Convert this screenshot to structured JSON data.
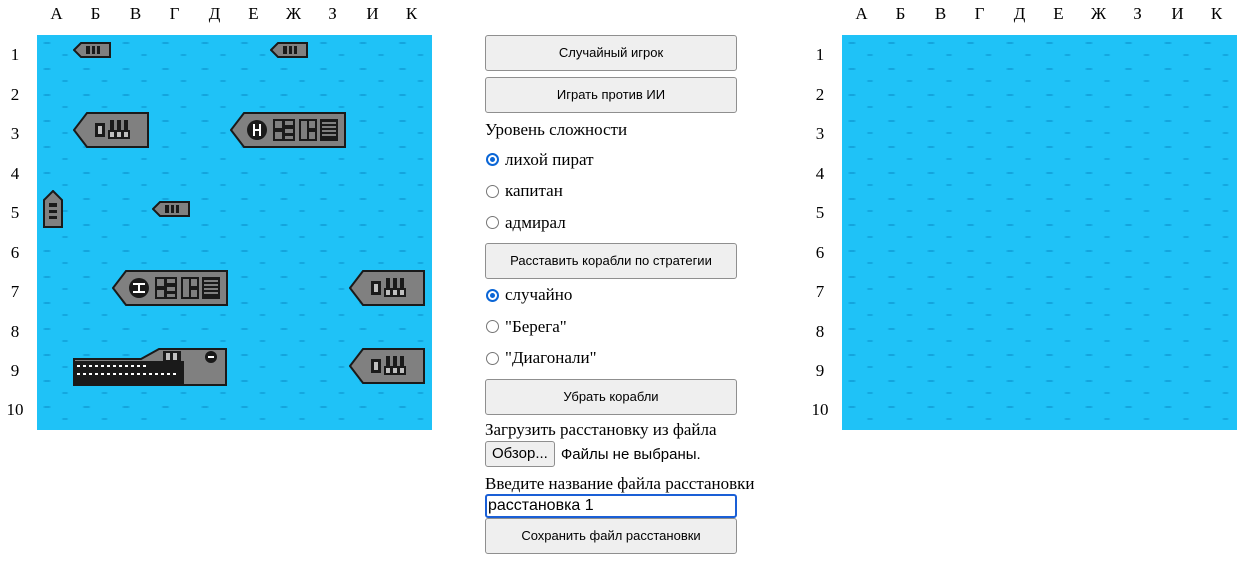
{
  "columns": [
    "А",
    "Б",
    "В",
    "Г",
    "Д",
    "Е",
    "Ж",
    "З",
    "И",
    "К"
  ],
  "rows": [
    "1",
    "2",
    "3",
    "4",
    "5",
    "6",
    "7",
    "8",
    "9",
    "10"
  ],
  "colors": {
    "water": "#1fc2f7",
    "ship_hull": "#808080",
    "ship_outline": "#1a1a1a",
    "radio_checked": "#0b66d6"
  },
  "player_board": {
    "ships": [
      {
        "type": "boat",
        "col": "Б",
        "row": 1,
        "size": 1,
        "orientation": "horizontal",
        "facing": "left"
      },
      {
        "type": "boat",
        "col": "Ж",
        "row": 1,
        "size": 1,
        "orientation": "horizontal",
        "facing": "left"
      },
      {
        "type": "cruiser",
        "col": "Б",
        "row": 3,
        "size": 2,
        "orientation": "horizontal",
        "facing": "left"
      },
      {
        "type": "battleship",
        "col": "Е",
        "row": 3,
        "size": 3,
        "orientation": "horizontal",
        "facing": "left"
      },
      {
        "type": "boat",
        "col": "А",
        "row": 5,
        "size": 1,
        "orientation": "vertical",
        "facing": "up"
      },
      {
        "type": "boat",
        "col": "Г",
        "row": 5,
        "size": 1,
        "orientation": "horizontal",
        "facing": "left"
      },
      {
        "type": "battleship",
        "col": "В",
        "row": 7,
        "size": 3,
        "orientation": "horizontal",
        "facing": "left"
      },
      {
        "type": "cruiser",
        "col": "И",
        "row": 7,
        "size": 2,
        "orientation": "horizontal",
        "facing": "left"
      },
      {
        "type": "carrier",
        "col": "Б",
        "row": 9,
        "size": 4,
        "orientation": "horizontal",
        "facing": "right"
      },
      {
        "type": "cruiser",
        "col": "И",
        "row": 9,
        "size": 2,
        "orientation": "horizontal",
        "facing": "left"
      }
    ]
  },
  "enemy_board": {
    "ships": []
  },
  "controls": {
    "random_player_label": "Случайный игрок",
    "play_ai_label": "Играть против ИИ",
    "difficulty_heading": "Уровень сложности",
    "difficulty_options": [
      {
        "label": "лихой пират",
        "checked": true
      },
      {
        "label": "капитан",
        "checked": false
      },
      {
        "label": "адмирал",
        "checked": false
      }
    ],
    "place_strategy_label": "Расставить корабли по стратегии",
    "strategy_options": [
      {
        "label": "случайно",
        "checked": true
      },
      {
        "label": "\"Берега\"",
        "checked": false
      },
      {
        "label": "\"Диагонали\"",
        "checked": false
      }
    ],
    "remove_ships_label": "Убрать корабли",
    "load_heading": "Загрузить расстановку из файла",
    "browse_label": "Обзор...",
    "file_status": "Файлы не выбраны.",
    "filename_heading": "Введите название файла расстановки",
    "filename_value": "расстановка 1",
    "save_label": "Сохранить файл расстановки"
  }
}
